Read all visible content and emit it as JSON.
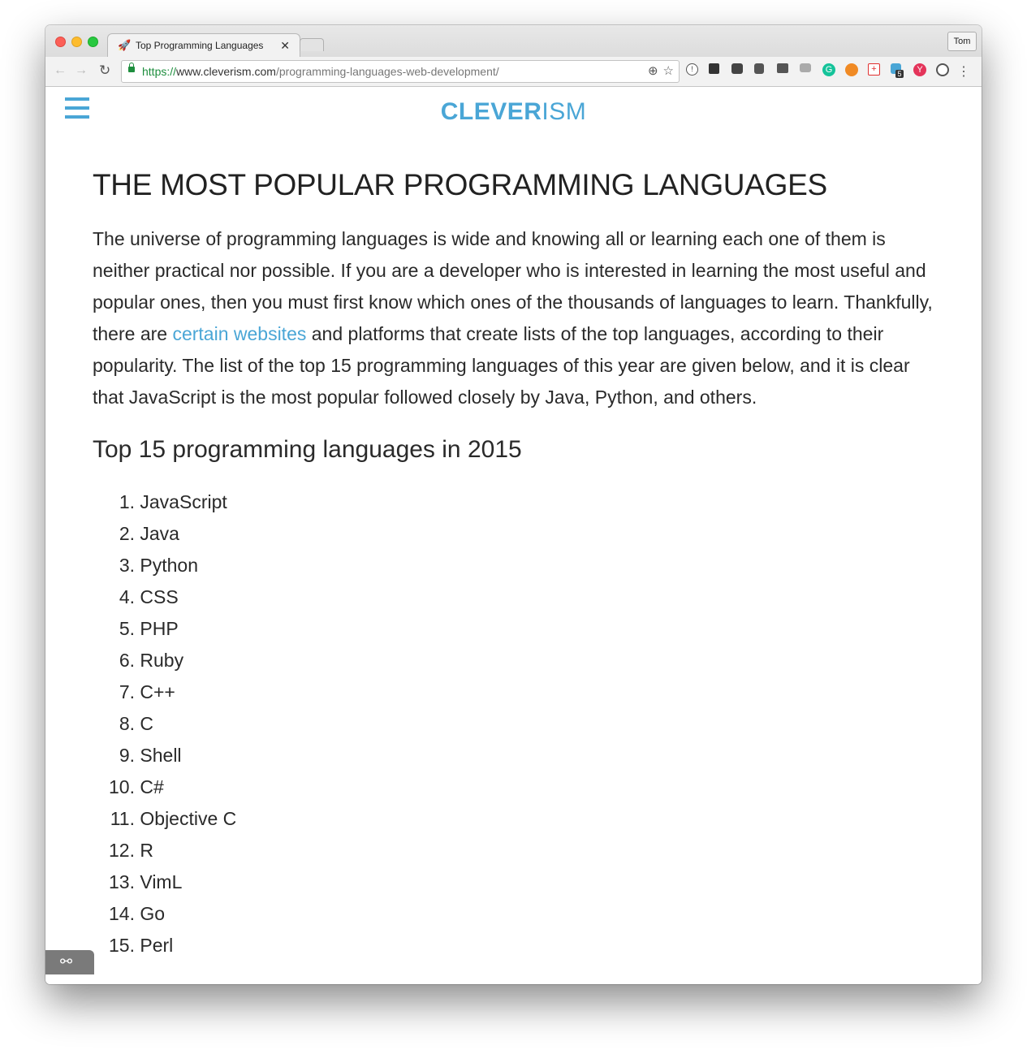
{
  "browser": {
    "tab_title": "Top Programming Languages",
    "tab_icon": "rocket-icon",
    "profile_label": "Tom",
    "url_protocol": "https://",
    "url_host": "www.cleverism.com",
    "url_path": "/programming-languages-web-development/",
    "extension_badge": "5"
  },
  "site": {
    "logo_bold": "CLEVER",
    "logo_light": "ISM",
    "accent_color": "#4aa6d6"
  },
  "article": {
    "title": "THE MOST POPULAR PROGRAMMING LANGUAGES",
    "intro_part1": "The universe of programming languages is wide and knowing all or learning each one of them is neither practical nor possible. If you are a developer who is interested in learning the most useful and popular ones, then you must first know which ones of the thousands of languages to learn. Thankfully, there are ",
    "intro_link": "certain websites",
    "intro_part2": " and platforms that create lists of the top languages, according to their popularity. The list of the top 15 programming languages of this year are given below, and it is clear that JavaScript is the most popular followed closely by Java, Python, and others.",
    "list_heading": "Top 15 programming languages in 2015",
    "languages": [
      {
        "num": "1.",
        "name": "JavaScript"
      },
      {
        "num": "2.",
        "name": "Java"
      },
      {
        "num": "3.",
        "name": "Python"
      },
      {
        "num": "4.",
        "name": "CSS"
      },
      {
        "num": "5.",
        "name": "PHP"
      },
      {
        "num": "6.",
        "name": "Ruby"
      },
      {
        "num": "7.",
        "name": "C++"
      },
      {
        "num": "8.",
        "name": "C"
      },
      {
        "num": "9.",
        "name": "Shell"
      },
      {
        "num": "10.",
        "name": "C#"
      },
      {
        "num": "11.",
        "name": "Objective C"
      },
      {
        "num": "12.",
        "name": "R"
      },
      {
        "num": "13.",
        "name": "VimL"
      },
      {
        "num": "14.",
        "name": "Go"
      },
      {
        "num": "15.",
        "name": "Perl"
      }
    ]
  }
}
